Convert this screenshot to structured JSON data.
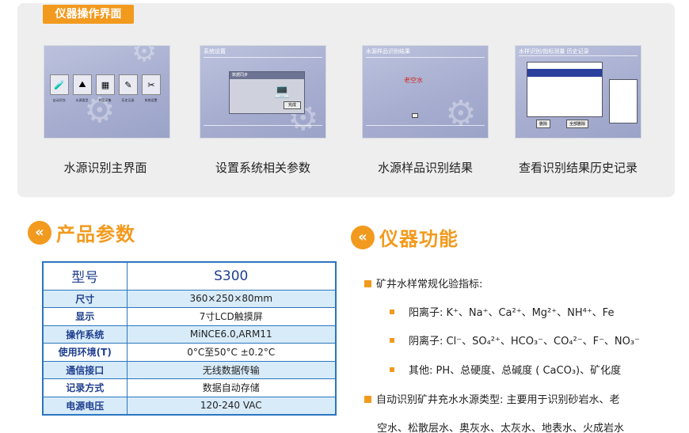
{
  "top_section": {
    "tag": "仪器操作界面",
    "screens": [
      {
        "caption": "水源识别主界面",
        "icon_labels": [
          "自动识别",
          "水源类型",
          "样品采集",
          "历史记录",
          "系统设置"
        ]
      },
      {
        "caption": "设置系统相关参数",
        "window_title": "系统设置",
        "dialog_title": "数据同步",
        "ok_label": "完成"
      },
      {
        "caption": "水源样品识别结果",
        "window_title": "水源样品识别结果",
        "result_text": "老空水"
      },
      {
        "caption": "查看识别结果历史记录",
        "window_title": "水样识别/指标测量 历史记录",
        "btn_delete": "删除",
        "btn_export": "全部删除"
      }
    ]
  },
  "params_section": {
    "title": "产品参数",
    "header": {
      "key": "型号",
      "value": "S300"
    },
    "rows": [
      {
        "key": "尺寸",
        "value": "360×250×80mm"
      },
      {
        "key": "显示",
        "value": "7寸LCD触摸屏"
      },
      {
        "key": "操作系统",
        "value": "MiNCE6.0,ARM11"
      },
      {
        "key": "使用环境(T)",
        "value": "0°C至50°C ±0.2°C"
      },
      {
        "key": "通信接口",
        "value": "无线数据传输"
      },
      {
        "key": "记录方式",
        "value": "数据自动存储"
      },
      {
        "key": "电源电压",
        "value": "120-240 VAC"
      }
    ]
  },
  "functions_section": {
    "title": "仪器功能",
    "item1": "矿井水样常规化验指标:",
    "cation_label": "阳离子: ",
    "cation_items": "K⁺、Na⁺、Ca²⁺、Mg²⁺、NH⁴⁺、Fe",
    "anion_label": "阴离子: ",
    "anion_items": "Cl⁻、SO₄²⁺、HCO₃⁻、CO₄²⁻、F⁻、NO₃⁻",
    "other_label": "其他: ",
    "other_items": "PH、总硬度、总碱度 ( CaCO₃)、矿化度",
    "item2": "自动识别矿井充水水源类型: 主要用于识别砂岩水、老",
    "item2_cont": "空水、松散层水、奥灰水、太灰水、地表水、火成岩水"
  },
  "colors": {
    "accent": "#f29a1e",
    "table_border": "#2a76bf",
    "table_stripe": "#d8ebf9"
  },
  "icons": [
    "double-chevron-left-icon",
    "gear-icon"
  ]
}
